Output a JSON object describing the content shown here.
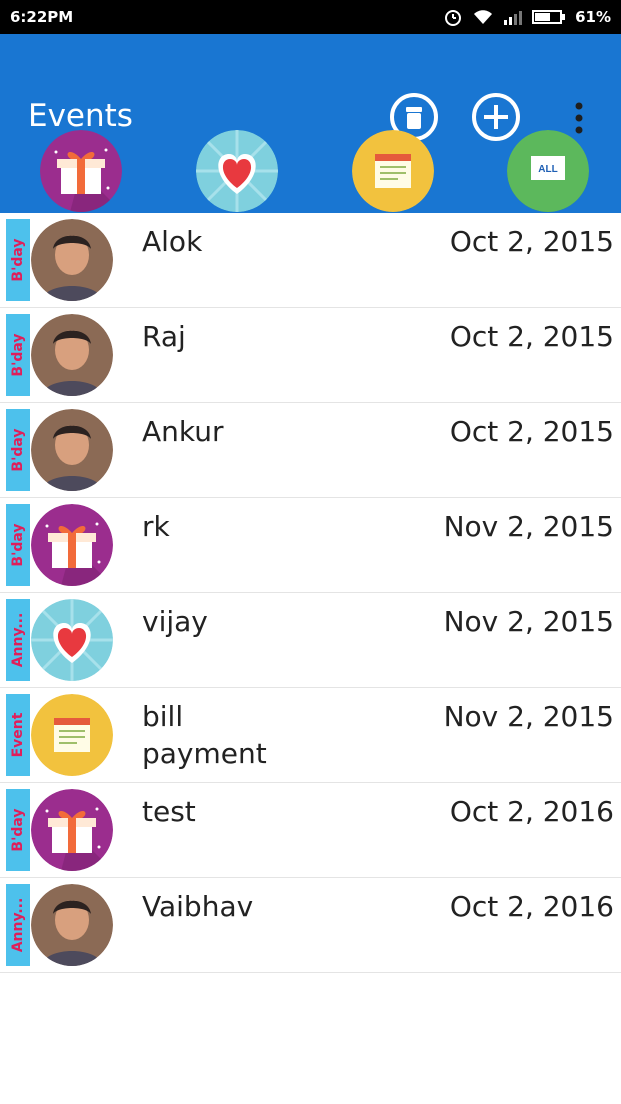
{
  "status": {
    "time": "6:22PM",
    "battery": "61%"
  },
  "appbar": {
    "title": "Events",
    "categories": [
      {
        "icon": "gift-icon"
      },
      {
        "icon": "heart-icon"
      },
      {
        "icon": "notepad-icon"
      },
      {
        "icon": "all-icon",
        "label": "ALL"
      }
    ]
  },
  "events": [
    {
      "tag": "B'day",
      "name": "Alok",
      "date": "Oct 2, 2015",
      "avatar": "person-photo"
    },
    {
      "tag": "B'day",
      "name": "Raj",
      "date": "Oct 2, 2015",
      "avatar": "person-photo"
    },
    {
      "tag": "B'day",
      "name": "Ankur",
      "date": "Oct 2, 2015",
      "avatar": "person-photo"
    },
    {
      "tag": "B'day",
      "name": "rk",
      "date": "Nov 2, 2015",
      "avatar": "gift-icon"
    },
    {
      "tag": "Anny...",
      "name": "vijay",
      "date": "Nov 2, 2015",
      "avatar": "heart-icon"
    },
    {
      "tag": "Event",
      "name": "bill payment",
      "date": "Nov 2, 2015",
      "avatar": "notepad-icon"
    },
    {
      "tag": "B'day",
      "name": "test",
      "date": "Oct 2, 2016",
      "avatar": "gift-icon"
    },
    {
      "tag": "Anny...",
      "name": "Vaibhav",
      "date": "Oct 2, 2016",
      "avatar": "person-photo"
    }
  ],
  "colors": {
    "appbar": "#1976d2",
    "tag_bg": "#4dc1ec",
    "tag_text": "#e01e5a"
  }
}
